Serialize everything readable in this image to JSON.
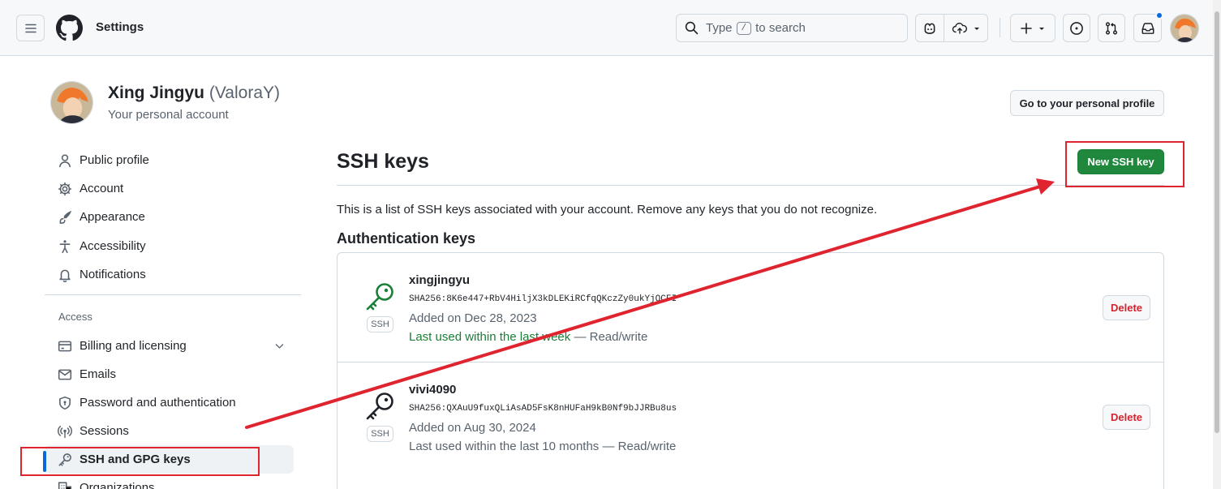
{
  "header": {
    "title": "Settings",
    "search": {
      "prefix": "Type",
      "key": "/",
      "suffix": "to search"
    },
    "icons": [
      "hamburger-menu-icon",
      "github-logo",
      "copilot-icon",
      "cloud-icon",
      "plus-icon",
      "issue-icon",
      "pull-request-icon",
      "inbox-icon"
    ],
    "has_unread_notifications": true
  },
  "profile": {
    "name": "Xing Jingyu",
    "login": "(ValoraY)",
    "subtitle": "Your personal account",
    "goto_label": "Go to your personal profile"
  },
  "sidebar": {
    "items": [
      {
        "label": "Public profile",
        "icon": "person-icon"
      },
      {
        "label": "Account",
        "icon": "gear-icon"
      },
      {
        "label": "Appearance",
        "icon": "paintbrush-icon"
      },
      {
        "label": "Accessibility",
        "icon": "accessibility-icon"
      },
      {
        "label": "Notifications",
        "icon": "bell-icon"
      }
    ],
    "access_heading": "Access",
    "access_items": [
      {
        "label": "Billing and licensing",
        "icon": "credit-card-icon"
      },
      {
        "label": "Emails",
        "icon": "mail-icon"
      },
      {
        "label": "Password and authentication",
        "icon": "shield-lock-icon"
      },
      {
        "label": "Sessions",
        "icon": "broadcast-icon"
      },
      {
        "label": "SSH and GPG keys",
        "icon": "key-icon",
        "active": true
      },
      {
        "label": "Organizations",
        "icon": "organization-icon"
      }
    ]
  },
  "main": {
    "title": "SSH keys",
    "new_key_label": "New SSH key",
    "intro": "This is a list of SSH keys associated with your account. Remove any keys that you do not recognize.",
    "subtitle": "Authentication keys",
    "keys": [
      {
        "title": "xingjingyu",
        "type": "SSH",
        "fingerprint": "SHA256:8K6e447+RbV4HiljX3kDLEKiRCfqQKczZy0ukYjQCFI",
        "added": "Added on Dec 28, 2023",
        "last_used": "Last used within the last week",
        "access": " — Read/write",
        "recent": true,
        "delete_label": "Delete"
      },
      {
        "title": "vivi4090",
        "type": "SSH",
        "fingerprint": "SHA256:QXAuU9fuxQLiAsAD5FsK8nHUFaH9kB0Nf9bJJRBu8us",
        "added": "Added on Aug 30, 2024",
        "last_used": "Last used within the last 10 months",
        "access": " — Read/write",
        "recent": false,
        "delete_label": "Delete"
      }
    ]
  },
  "colors": {
    "primary_green": "#1f883d",
    "danger_red": "#d1242f",
    "accent_blue": "#0969da",
    "annotation_red": "#e0242f"
  }
}
